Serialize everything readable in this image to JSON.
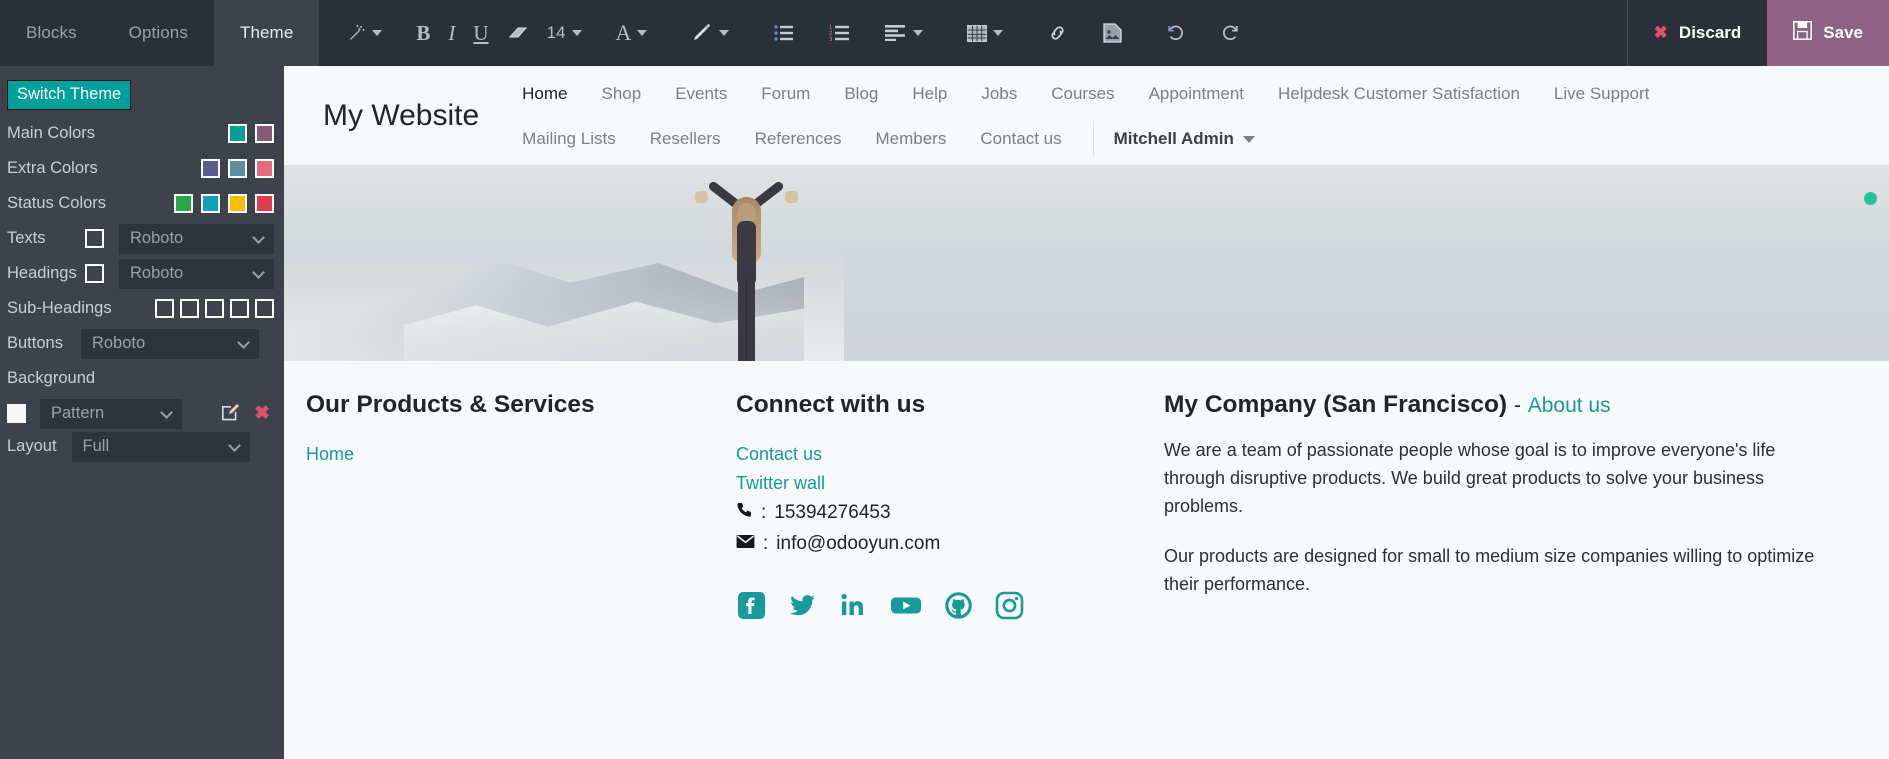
{
  "topbar": {
    "tabs": [
      {
        "label": "Blocks",
        "active": false
      },
      {
        "label": "Options",
        "active": false
      },
      {
        "label": "Theme",
        "active": true
      }
    ],
    "toolbar": {
      "magic_wand": "magic-wand-icon",
      "bold": "B",
      "italic": "I",
      "underline": "U",
      "clear_format": "eraser-icon",
      "font_size": "14",
      "font_family": "A",
      "paint": "brush-icon",
      "bullet_list": "unordered-list-icon",
      "numbered_list": "ordered-list-icon",
      "align": "align-left-icon",
      "table": "table-icon",
      "link": "link-icon",
      "image": "image-icon",
      "undo": "undo-icon",
      "redo": "redo-icon"
    },
    "discard_label": "Discard",
    "save_label": "Save"
  },
  "sidebar": {
    "switch_theme_label": "Switch Theme",
    "switch_theme_color": "#00a09d",
    "rows": {
      "main_colors": {
        "label": "Main Colors",
        "swatches": [
          "#00a09d",
          "#875a7b"
        ]
      },
      "extra_colors": {
        "label": "Extra Colors",
        "swatches": [
          "#5b5f8d",
          "#5e8ca0",
          "#e76a7c"
        ]
      },
      "status_colors": {
        "label": "Status Colors",
        "swatches": [
          "#28a745",
          "#0fa2bd",
          "#fcbe04",
          "#e03b4e"
        ]
      },
      "texts": {
        "label": "Texts",
        "font": "Roboto",
        "checkbox": false
      },
      "headings": {
        "label": "Headings",
        "font": "Roboto",
        "checkbox": false
      },
      "sub_headings": {
        "label": "Sub-Headings",
        "checkboxes": [
          false,
          false,
          false,
          false,
          false
        ]
      },
      "buttons": {
        "label": "Buttons",
        "font": "Roboto"
      },
      "background": {
        "label": "Background",
        "swatch": "#ffffff",
        "value": "Pattern",
        "edit_icon": "edit-square-icon",
        "remove_icon": "remove-x-icon"
      },
      "layout": {
        "label": "Layout",
        "value": "Full"
      }
    }
  },
  "website": {
    "brand": "My Website",
    "nav_row1": [
      {
        "label": "Home",
        "active": true
      },
      {
        "label": "Shop",
        "active": false
      },
      {
        "label": "Events",
        "active": false
      },
      {
        "label": "Forum",
        "active": false
      },
      {
        "label": "Blog",
        "active": false
      },
      {
        "label": "Help",
        "active": false
      },
      {
        "label": "Jobs",
        "active": false
      },
      {
        "label": "Courses",
        "active": false
      },
      {
        "label": "Appointment",
        "active": false
      },
      {
        "label": "Helpdesk Customer Satisfaction",
        "active": false
      },
      {
        "label": "Live Support",
        "active": false
      }
    ],
    "nav_row2": [
      {
        "label": "Mailing Lists"
      },
      {
        "label": "Resellers"
      },
      {
        "label": "References"
      },
      {
        "label": "Members"
      },
      {
        "label": "Contact us"
      }
    ],
    "user": "Mitchell Admin",
    "hero": {
      "alt": "woman with raised arms on mountain"
    },
    "footer": {
      "col1": {
        "heading": "Our Products & Services",
        "links": [
          "Home"
        ]
      },
      "col2": {
        "heading": "Connect with us",
        "links": [
          "Contact us",
          "Twitter wall"
        ],
        "phone_label": ":",
        "phone": "15394276453",
        "email_label": ":",
        "email": "info@odooyun.com",
        "socials": [
          "facebook-icon",
          "twitter-icon",
          "linkedin-icon",
          "youtube-icon",
          "github-icon",
          "instagram-icon"
        ],
        "social_color": "#179a9c"
      },
      "col3": {
        "heading": "My Company (San Francisco)",
        "heading_dash": "-",
        "about_link": "About us",
        "paragraph1": "We are a team of passionate people whose goal is to improve everyone's life through disruptive products. We build great products to solve your business problems.",
        "paragraph2": "Our products are designed for small to medium size companies willing to optimize their performance."
      }
    }
  }
}
